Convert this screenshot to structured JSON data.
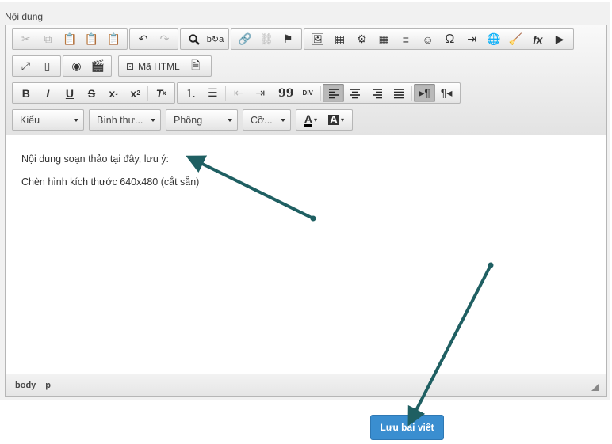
{
  "field_label": "Nội dung",
  "toolbar": {
    "html_mode_label": "Mã HTML",
    "style_combo": "Kiểu",
    "format_combo": "Bình thư...",
    "font_combo": "Phông",
    "size_combo": "Cỡ...",
    "btn_bold": "B",
    "btn_italic": "I",
    "btn_underline": "U",
    "btn_strike": "S",
    "btn_omega": "Ω",
    "btn_formula": "fx",
    "btn_quote": "99",
    "btn_div": "DIV"
  },
  "content": {
    "paragraphs": [
      "Nội dung soạn thảo tại đây, lưu ý:",
      "Chèn hình kích thước 640x480 (cắt sẵn)"
    ]
  },
  "statusbar": {
    "path": [
      "body",
      "p"
    ]
  },
  "save_button": "Lưu bài viết",
  "colors": {
    "accent": "#3a8ed0",
    "arrow": "#1f5f62"
  },
  "annotations": [
    {
      "from": "content-right",
      "to": "paragraph-1-end"
    },
    {
      "from": "content-lower-right",
      "to": "save-button"
    }
  ]
}
